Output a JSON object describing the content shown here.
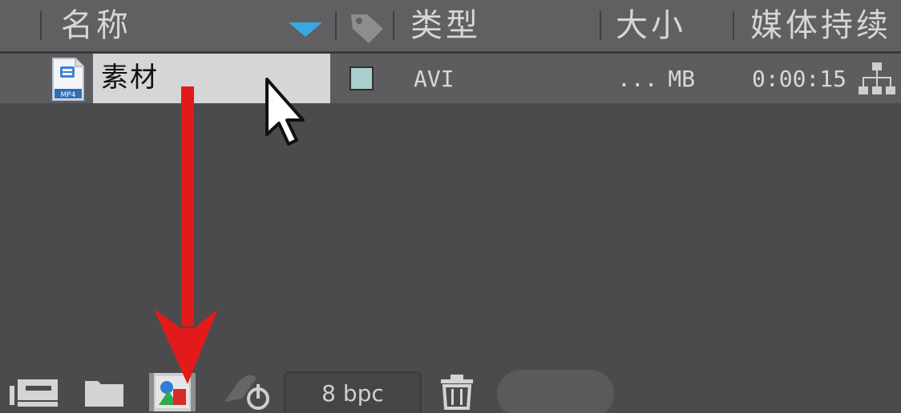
{
  "header": {
    "col_name": "名称",
    "col_type": "类型",
    "col_size": "大小",
    "col_duration": "媒体持续"
  },
  "row": {
    "name": "素材",
    "type": "AVI",
    "size": "... MB",
    "duration": "0:00:15",
    "label_color": "#a9cfcc",
    "file_icon_label": "MP4"
  },
  "toolbar": {
    "bpc_label": "8 bpc",
    "icons": [
      "interpret-footage-icon",
      "new-folder-icon",
      "new-composition-icon",
      "flowchart-icon",
      "delete-icon"
    ]
  },
  "colors": {
    "accent_sort": "#3aa8e0",
    "annotation_arrow": "#e21a1a"
  }
}
